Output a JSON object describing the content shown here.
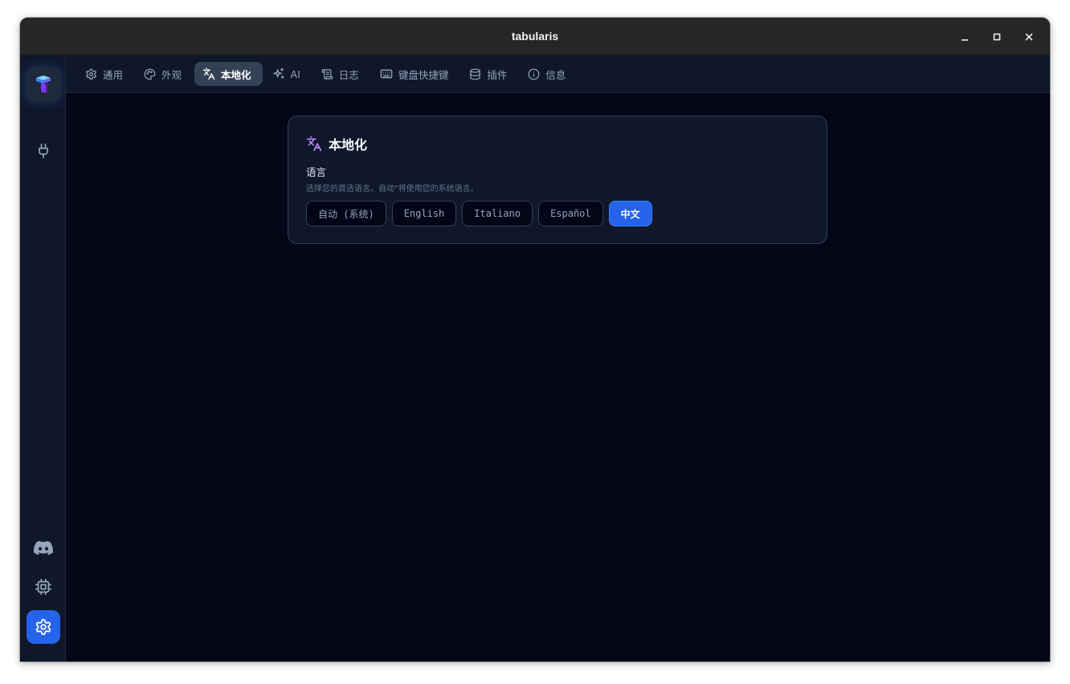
{
  "window": {
    "title": "tabularis"
  },
  "tabs": [
    {
      "label": "通用",
      "icon": "gear-icon",
      "active": false
    },
    {
      "label": "外观",
      "icon": "palette-icon",
      "active": false
    },
    {
      "label": "本地化",
      "icon": "translate-icon",
      "active": true
    },
    {
      "label": "AI",
      "icon": "sparkles-icon",
      "active": false
    },
    {
      "label": "日志",
      "icon": "scroll-icon",
      "active": false
    },
    {
      "label": "键盘快捷键",
      "icon": "keyboard-icon",
      "active": false
    },
    {
      "label": "插件",
      "icon": "database-icon",
      "active": false
    },
    {
      "label": "信息",
      "icon": "info-icon",
      "active": false
    }
  ],
  "localization": {
    "title": "本地化",
    "language_label": "语言",
    "language_desc": "选择您的首选语言。自动\"将使用您的系统语言。",
    "options": [
      "自动 (系统)",
      "English",
      "Italiano",
      "Español",
      "中文"
    ],
    "selected": "中文"
  },
  "colors": {
    "accent": "#2563eb",
    "translate_icon": "#c084fc",
    "background": "#020617",
    "panel": "#0f172a"
  }
}
